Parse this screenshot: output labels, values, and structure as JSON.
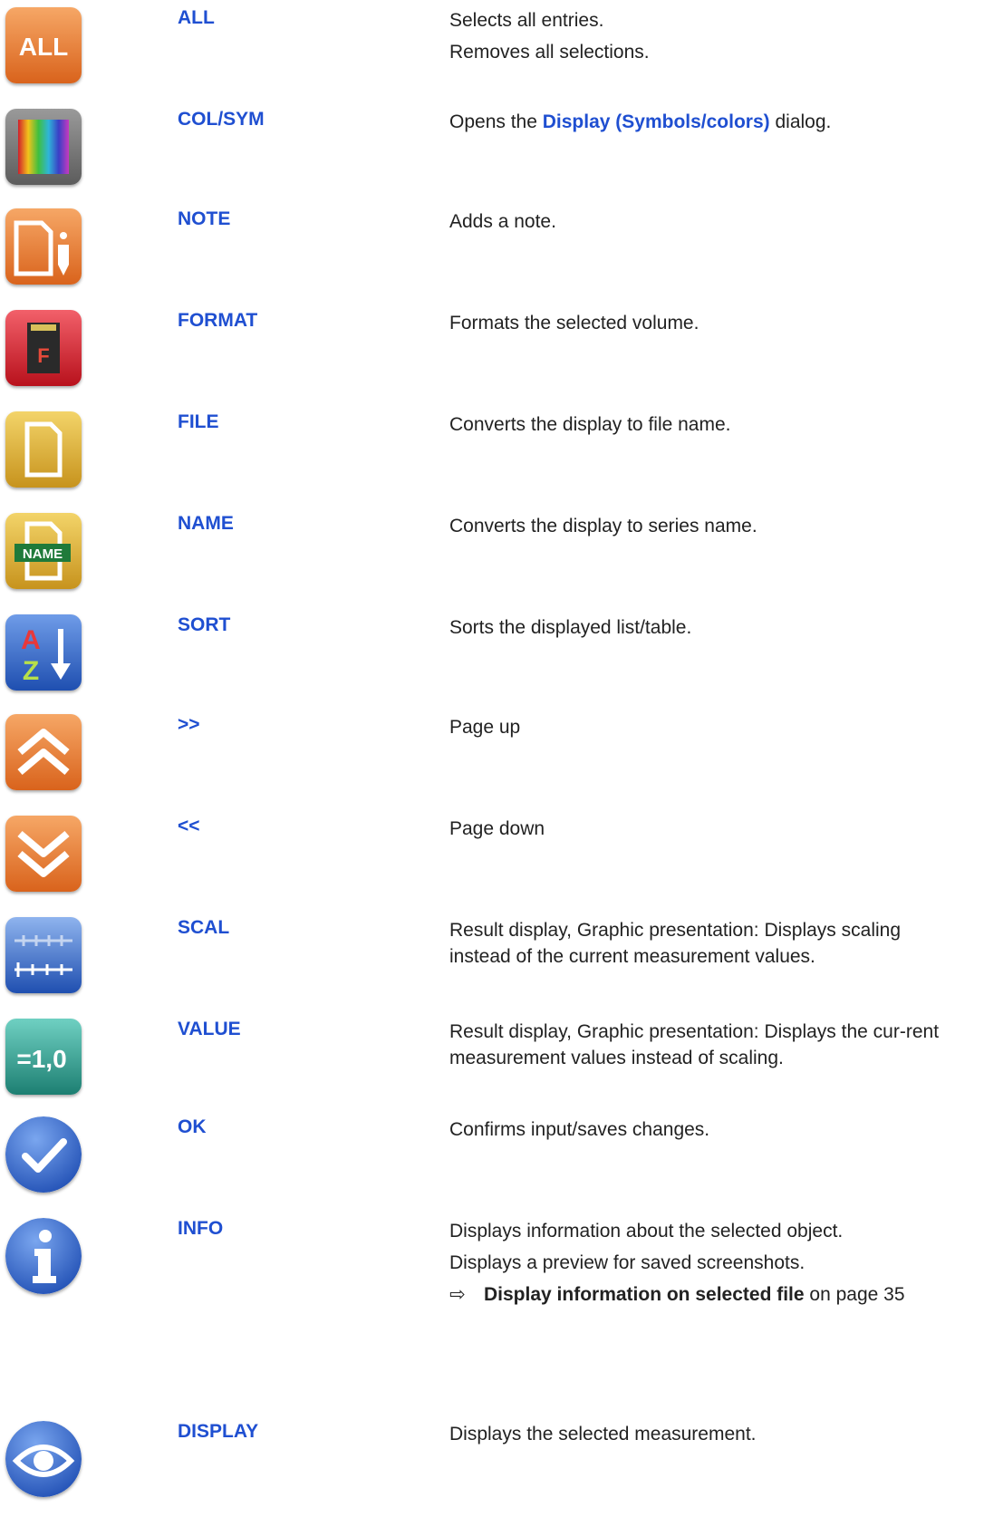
{
  "rows": [
    {
      "key": "ALL",
      "icon": "all-icon",
      "desc": [
        "Selects all entries.",
        "Removes all selections."
      ]
    },
    {
      "key": "COL/SYM",
      "icon": "color-spectrum-icon",
      "desc_pre": "Opens the ",
      "desc_link": "Display (Symbols/colors)",
      "desc_post": " dialog."
    },
    {
      "key": "NOTE",
      "icon": "note-icon",
      "desc": [
        "Adds a note."
      ]
    },
    {
      "key": "FORMAT",
      "icon": "format-sd-card-icon",
      "icon_text": "F",
      "desc": [
        "Formats the selected volume."
      ]
    },
    {
      "key": "FILE",
      "icon": "file-icon",
      "desc": [
        "Converts the display to file name."
      ]
    },
    {
      "key": "NAME",
      "icon": "name-icon",
      "icon_text": "NAME",
      "desc": [
        "Converts the display to series name."
      ]
    },
    {
      "key": "SORT",
      "icon": "sort-az-icon",
      "icon_text_a": "A",
      "icon_text_z": "Z",
      "desc": [
        "Sorts the displayed list/table."
      ]
    },
    {
      "key": ">>",
      "icon": "page-up-icon",
      "desc": [
        "Page up"
      ]
    },
    {
      "key": "<<",
      "icon": "page-down-icon",
      "desc": [
        "Page down"
      ]
    },
    {
      "key": "SCAL",
      "icon": "scale-icon",
      "desc": [
        "Result display, Graphic presentation: Displays scaling instead of the current measurement values."
      ]
    },
    {
      "key": "VALUE",
      "icon": "value-icon",
      "icon_text": "=1,0",
      "desc": [
        "Result display, Graphic presentation: Displays the cur-rent measurement values instead of scaling."
      ]
    },
    {
      "key": "OK",
      "icon": "checkmark-icon",
      "desc": [
        "Confirms input/saves changes."
      ]
    },
    {
      "key": "INFO",
      "icon": "info-icon",
      "desc": [
        "Displays information about the selected object.",
        "Displays a preview for saved screenshots."
      ],
      "xref_arrow": "⇨",
      "xref_bold": "Display information on selected file",
      "xref_rest": " on page 35"
    },
    {
      "key": "DISPLAY",
      "icon": "eye-icon",
      "desc": [
        "Displays the selected measurement."
      ]
    }
  ],
  "colors": {
    "accent_blue": "#1f4fd1",
    "orange": "#e5792a",
    "red": "#d62a34",
    "yellow": "#e3b42c",
    "blue": "#2e66c9",
    "teal": "#2f9c8e",
    "gray": "#6e6e6e"
  }
}
